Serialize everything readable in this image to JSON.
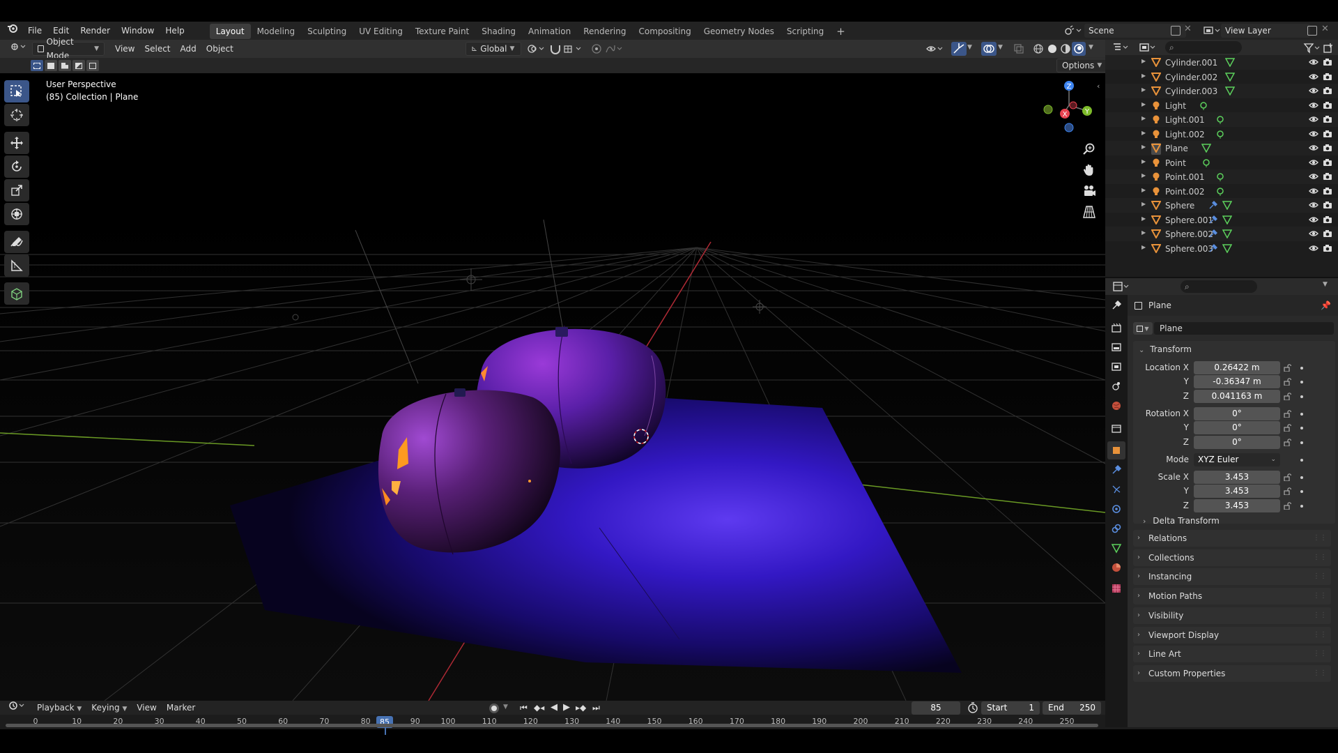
{
  "menubar": {
    "items": [
      "File",
      "Edit",
      "Render",
      "Window",
      "Help"
    ],
    "workspaces": [
      "Layout",
      "Modeling",
      "Sculpting",
      "UV Editing",
      "Texture Paint",
      "Shading",
      "Animation",
      "Rendering",
      "Compositing",
      "Geometry Nodes",
      "Scripting"
    ],
    "active_workspace": "Layout",
    "add_tab": "+",
    "scene": "Scene",
    "view_layer": "View Layer"
  },
  "viewport_header": {
    "mode": "Object Mode",
    "menus": [
      "View",
      "Select",
      "Add",
      "Object"
    ],
    "transform_orientation": "Global",
    "options": "Options"
  },
  "viewport": {
    "perspective": "User Perspective",
    "collection_info": "(85) Collection | Plane",
    "gizmo_axes": {
      "x": "X",
      "y": "Y",
      "z": "Z"
    },
    "colors": {
      "x_axis": "#e8424f",
      "y_axis": "#7dbb2a",
      "z_axis": "#3d84f0",
      "plane": "#3a1ed8",
      "pumpkin": "#7a2a8a",
      "glow": "#ff9a20"
    }
  },
  "outliner": {
    "items": [
      {
        "name": "Cylinder.001",
        "icon": "mesh-icon"
      },
      {
        "name": "Cylinder.002",
        "icon": "mesh-icon"
      },
      {
        "name": "Cylinder.003",
        "icon": "mesh-icon"
      },
      {
        "name": "Light",
        "icon": "light-icon"
      },
      {
        "name": "Light.001",
        "icon": "light-icon"
      },
      {
        "name": "Light.002",
        "icon": "light-icon"
      },
      {
        "name": "Plane",
        "icon": "mesh-icon"
      },
      {
        "name": "Point",
        "icon": "light-icon"
      },
      {
        "name": "Point.001",
        "icon": "light-icon"
      },
      {
        "name": "Point.002",
        "icon": "light-icon"
      },
      {
        "name": "Sphere",
        "icon": "mesh-icon"
      },
      {
        "name": "Sphere.001",
        "icon": "mesh-icon"
      },
      {
        "name": "Sphere.002",
        "icon": "mesh-icon"
      },
      {
        "name": "Sphere.003",
        "icon": "mesh-icon"
      }
    ]
  },
  "properties": {
    "object_name": "Plane",
    "datablock_name": "Plane",
    "transform_label": "Transform",
    "location": {
      "label": "Location X",
      "y_label": "Y",
      "z_label": "Z",
      "x": "0.26422 m",
      "y": "-0.36347 m",
      "z": "0.041163 m"
    },
    "rotation": {
      "label": "Rotation X",
      "y_label": "Y",
      "z_label": "Z",
      "x": "0°",
      "y": "0°",
      "z": "0°"
    },
    "mode": {
      "label": "Mode",
      "value": "XYZ Euler"
    },
    "scale": {
      "label": "Scale X",
      "y_label": "Y",
      "z_label": "Z",
      "x": "3.453",
      "y": "3.453",
      "z": "3.453"
    },
    "delta_transform": "Delta Transform",
    "panels": [
      "Relations",
      "Collections",
      "Instancing",
      "Motion Paths",
      "Visibility",
      "Viewport Display",
      "Line Art",
      "Custom Properties"
    ]
  },
  "timeline": {
    "menus": [
      "Playback",
      "Keying",
      "View",
      "Marker"
    ],
    "current_frame": "85",
    "start_label": "Start",
    "start": "1",
    "end_label": "End",
    "end": "250",
    "ticks": [
      "0",
      "10",
      "20",
      "30",
      "40",
      "50",
      "60",
      "70",
      "80",
      "90",
      "100",
      "110",
      "120",
      "130",
      "140",
      "150",
      "160",
      "170",
      "180",
      "190",
      "200",
      "210",
      "220",
      "230",
      "240",
      "250"
    ]
  }
}
